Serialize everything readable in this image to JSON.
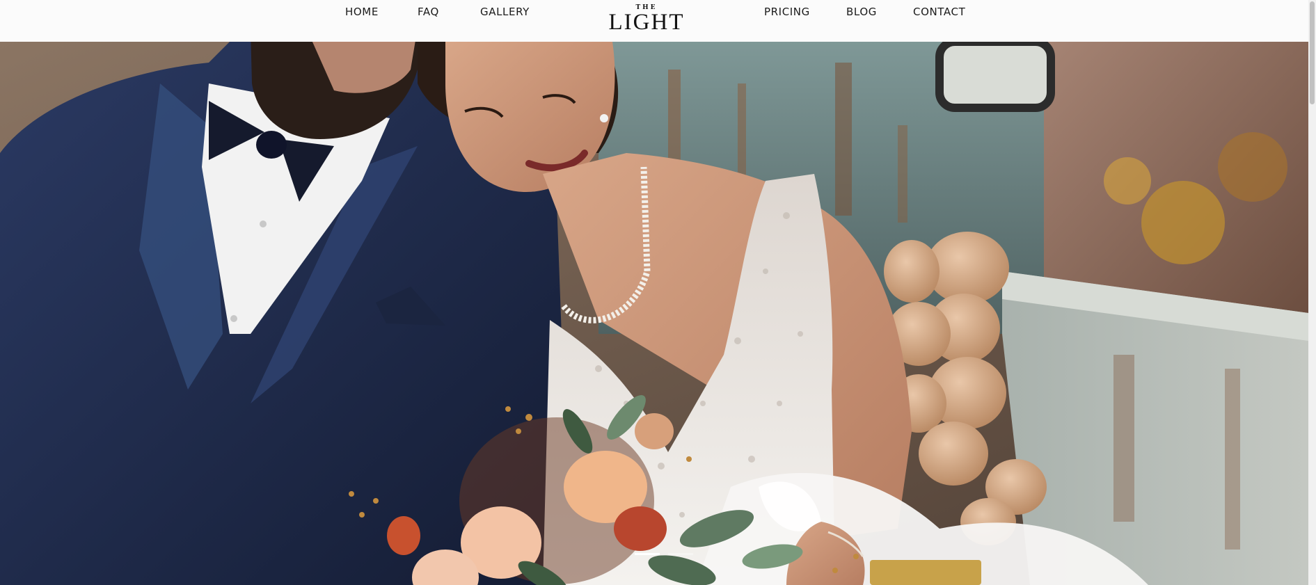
{
  "nav": {
    "left_items": [
      "HOME",
      "FAQ",
      "GALLERY"
    ],
    "right_items": [
      "PRICING",
      "BLOG",
      "CONTACT"
    ],
    "logo_top": "THE",
    "logo_main": "LIGHT"
  },
  "hero": {
    "image_subject": "wedding-couple-photo",
    "slides_total": 2,
    "active_slide": 1
  },
  "colors": {
    "nav_background": "#fbfbfb",
    "nav_text": "#1a1a1a",
    "suit_navy": "#1e2a48",
    "truck_teal": "#6f8a8a",
    "rust": "#8a5a3a",
    "dress_white": "#ece8e4"
  }
}
